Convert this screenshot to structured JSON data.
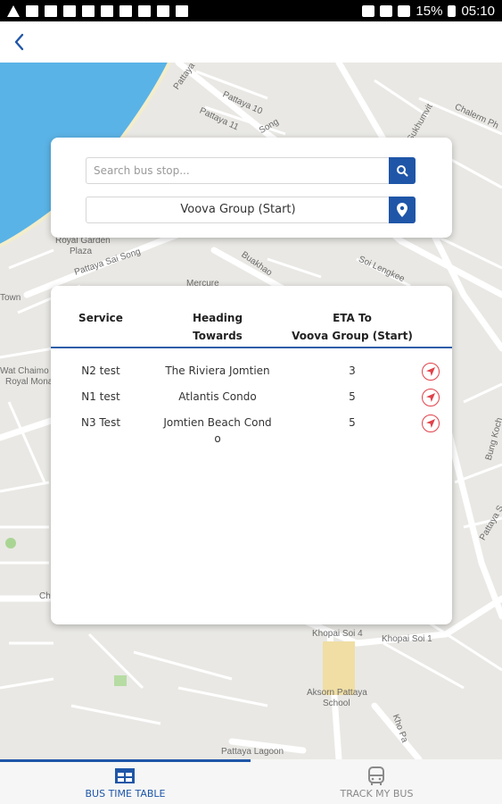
{
  "status_bar": {
    "battery": "15%",
    "time": "05:10"
  },
  "map": {
    "labels": {
      "pattaya_10": "Pattaya 10",
      "pattaya_11": "Pattaya 11",
      "song": "Song",
      "pattaya": "Pattaya",
      "chalerm": "Chalerm Ph",
      "sukhum": "Sukhumvit",
      "royal_garden": "Royal Garden",
      "plaza": "Plaza",
      "pattaya_sai_song": "Pattaya Sai Song",
      "buakhao": "Buakhao",
      "mercure": "Mercure",
      "soi_lengkee": "Soi Lengkee",
      "town": "Town",
      "wat_chaimongkol": "Wat Chaimo",
      "royal_mona": "Royal Mona",
      "khopai_4": "Khopai Soi 4",
      "khopai_1": "Khopai Soi 1",
      "aksorn": "Aksorn Pattaya",
      "school": "School",
      "lagoon": "Pattaya Lagoon",
      "bung_koch": "Bung Koch",
      "pattaya_s": "Pattaya S",
      "ch": "Ch",
      "khopai_r": "Kho Pa"
    }
  },
  "search": {
    "placeholder": "Search bus stop...",
    "selected_stop": "Voova Group (Start)",
    "search_icon": "search-icon",
    "location_icon": "map-pin-icon"
  },
  "results": {
    "headers": {
      "service": "Service",
      "heading_line1": "Heading",
      "heading_line2": "Towards",
      "eta_line1": "ETA To",
      "eta_line2": "Voova Group (Start)"
    },
    "rows": [
      {
        "service": "N2 test",
        "heading": "The Riviera Jomtien",
        "eta": "3",
        "icon": "navigate-icon"
      },
      {
        "service": "N1 test",
        "heading": "Atlantis Condo",
        "eta": "5",
        "icon": "navigate-icon"
      },
      {
        "service": "N3 Test",
        "heading_line1": "Jomtien Beach Cond",
        "heading_line2": "o",
        "eta": "5",
        "icon": "navigate-icon"
      }
    ]
  },
  "bottom_nav": {
    "tabs": [
      {
        "label": "BUS TIME TABLE",
        "icon": "timetable-icon",
        "active": true
      },
      {
        "label": "TRACK MY BUS",
        "icon": "bus-icon",
        "active": false
      }
    ]
  },
  "colors": {
    "primary": "#1f56a8",
    "accent_red": "#e0424a",
    "water": "#5ab3e6"
  }
}
